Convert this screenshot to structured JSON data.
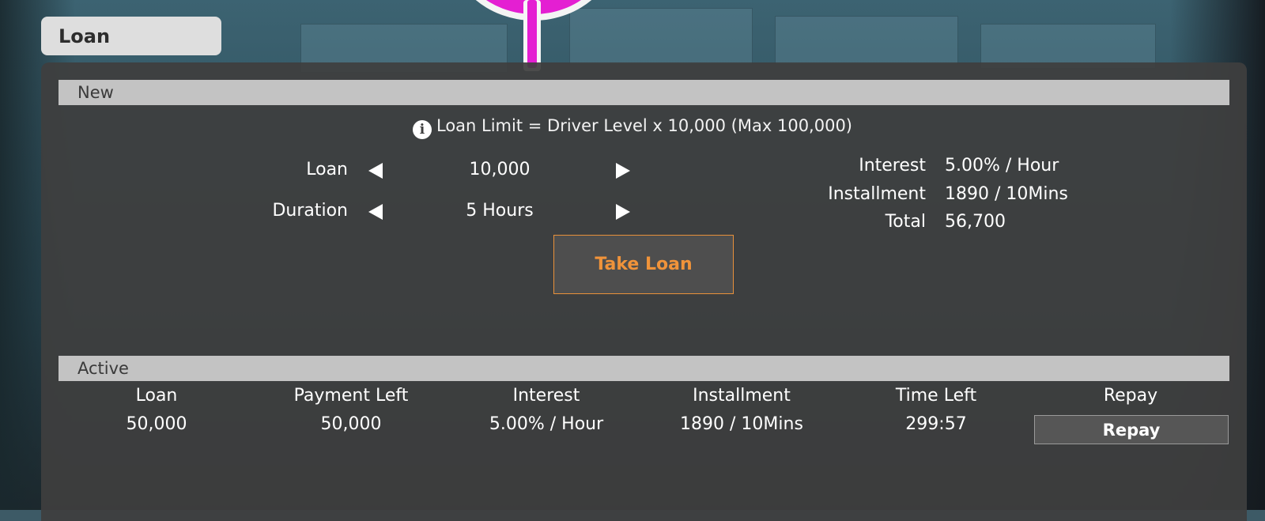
{
  "window": {
    "title": "Loan"
  },
  "new_section": {
    "header": "New",
    "limit_note": "Loan Limit = Driver Level x 10,000 (Max 100,000)",
    "loan": {
      "label": "Loan",
      "value": "10,000"
    },
    "duration": {
      "label": "Duration",
      "value": "5 Hours"
    },
    "summary": {
      "interest_label": "Interest",
      "interest_value": "5.00% / Hour",
      "installment_label": "Installment",
      "installment_value": "1890 / 10Mins",
      "total_label": "Total",
      "total_value": "56,700"
    },
    "take_loan_label": "Take Loan"
  },
  "active_section": {
    "header": "Active",
    "columns": [
      "Loan",
      "Payment Left",
      "Interest",
      "Installment",
      "Time Left",
      "Repay"
    ],
    "row": {
      "loan": "50,000",
      "payment_left": "50,000",
      "interest": "5.00% / Hour",
      "installment": "1890 / 10Mins",
      "time_left": "299:57"
    },
    "repay_button_label": "Repay"
  },
  "colors": {
    "accent_orange": "#f0933a",
    "panel_bg": "#3e3e3e",
    "section_bar": "#c3c3c3",
    "sign_magenta": "#e41fd2"
  }
}
